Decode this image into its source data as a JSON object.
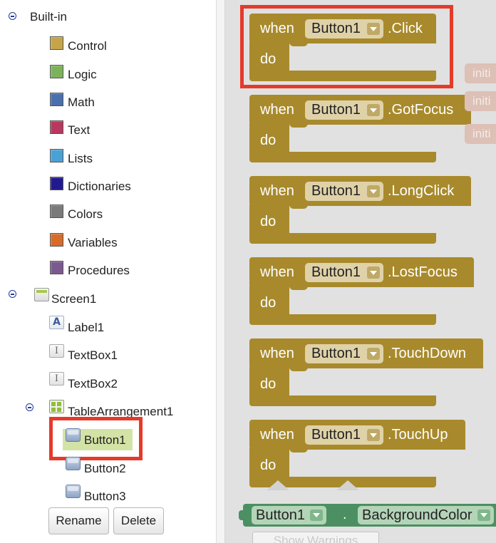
{
  "tree": {
    "builtin_label": "Built-in",
    "builtin_items": [
      {
        "label": "Control",
        "color": "#c6a54a"
      },
      {
        "label": "Logic",
        "color": "#7cb35a"
      },
      {
        "label": "Math",
        "color": "#4a6fad"
      },
      {
        "label": "Text",
        "color": "#b8385e"
      },
      {
        "label": "Lists",
        "color": "#4aa1d6"
      },
      {
        "label": "Dictionaries",
        "color": "#211a8e"
      },
      {
        "label": "Colors",
        "color": "#7a7a7a"
      },
      {
        "label": "Variables",
        "color": "#d86a2a"
      },
      {
        "label": "Procedures",
        "color": "#7a5a8e"
      }
    ],
    "screen_label": "Screen1",
    "components": [
      {
        "label": "Label1",
        "icon": "label-icon"
      },
      {
        "label": "TextBox1",
        "icon": "textbox-icon"
      },
      {
        "label": "TextBox2",
        "icon": "textbox-icon"
      }
    ],
    "arrangement_label": "TableArrangement1",
    "buttons": [
      {
        "label": "Button1",
        "icon": "button-icon",
        "selected": true
      },
      {
        "label": "Button2",
        "icon": "button-icon",
        "selected": false
      },
      {
        "label": "Button3",
        "icon": "button-icon",
        "selected": false
      }
    ],
    "rename_label": "Rename",
    "delete_label": "Delete"
  },
  "workspace": {
    "blocks": [
      {
        "when": "when",
        "component": "Button1",
        "event": ".Click",
        "do": "do"
      },
      {
        "when": "when",
        "component": "Button1",
        "event": ".GotFocus",
        "do": "do"
      },
      {
        "when": "when",
        "component": "Button1",
        "event": ".LongClick",
        "do": "do"
      },
      {
        "when": "when",
        "component": "Button1",
        "event": ".LostFocus",
        "do": "do"
      },
      {
        "when": "when",
        "component": "Button1",
        "event": ".TouchDown",
        "do": "do"
      },
      {
        "when": "when",
        "component": "Button1",
        "event": ".TouchUp",
        "do": "do"
      }
    ],
    "init_tags": [
      "initi",
      "initi",
      "initi"
    ],
    "property_block": {
      "component": "Button1",
      "dot": ".",
      "property": "BackgroundColor"
    },
    "warnings_button": "Show Warnings",
    "colors": {
      "event_block": "#a88a2c",
      "property_block": "#4b8f62",
      "highlight_red": "#e53a2a"
    }
  }
}
